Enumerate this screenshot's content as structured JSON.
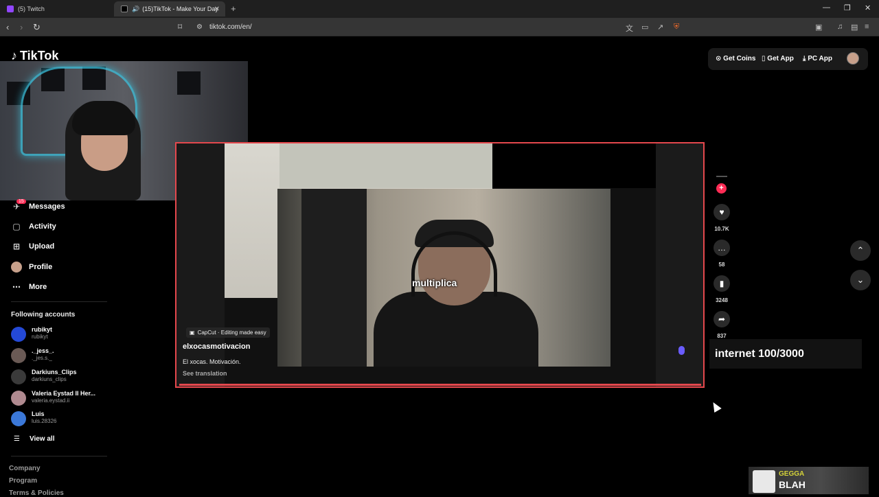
{
  "browser": {
    "tabs": [
      {
        "title": "(5) Twitch",
        "active": false
      },
      {
        "title": "(15)TikTok - Make Your Day",
        "active": true
      }
    ],
    "url": "tiktok.com/en/"
  },
  "app": {
    "logo": "TikTok"
  },
  "sidebar": {
    "messages_badge": "15",
    "items": [
      {
        "label": "Messages",
        "icon": "messages-icon"
      },
      {
        "label": "Activity",
        "icon": "activity-icon"
      },
      {
        "label": "Upload",
        "icon": "upload-icon"
      },
      {
        "label": "Profile",
        "icon": "profile-icon"
      },
      {
        "label": "More",
        "icon": "more-icon"
      }
    ],
    "following_title": "Following accounts",
    "accounts": [
      {
        "name": "rubikyt",
        "handle": "rubikyt",
        "color": "#2449d6"
      },
      {
        "name": "._jess_.",
        "handle": "._jes.s._",
        "color": "#6a5a55"
      },
      {
        "name": "Darkiuns_Clips",
        "handle": "darkiuns_clips",
        "color": "#3a3a3a"
      },
      {
        "name": "Valeria Eystad II Her...",
        "handle": "valeria.eystad.ii",
        "color": "#b08a90"
      },
      {
        "name": "Luis",
        "handle": "luis.28326",
        "color": "#3b78d8"
      }
    ],
    "view_all": "View all",
    "footer": [
      "Company",
      "Program",
      "Terms & Policies"
    ]
  },
  "top_actions": {
    "get_coins": "Get Coins",
    "get_app": "Get App",
    "pc_app": "PC App"
  },
  "video": {
    "caption": "multiplica",
    "capcut": "CapCut · Editing made easy",
    "author": "elxocasmotivacion",
    "description": "El xocas.   Motivación.",
    "see_translation": "See translation"
  },
  "actions": {
    "likes": "10.7K",
    "comments": "58",
    "saves": "3248",
    "shares": "837"
  },
  "overlay": {
    "internet": "internet  100/3000",
    "music_artist": "GEGGA",
    "music_title": "BLAH"
  },
  "colors": {
    "accent": "#fe2c55",
    "frame_border": "#e5484d"
  }
}
